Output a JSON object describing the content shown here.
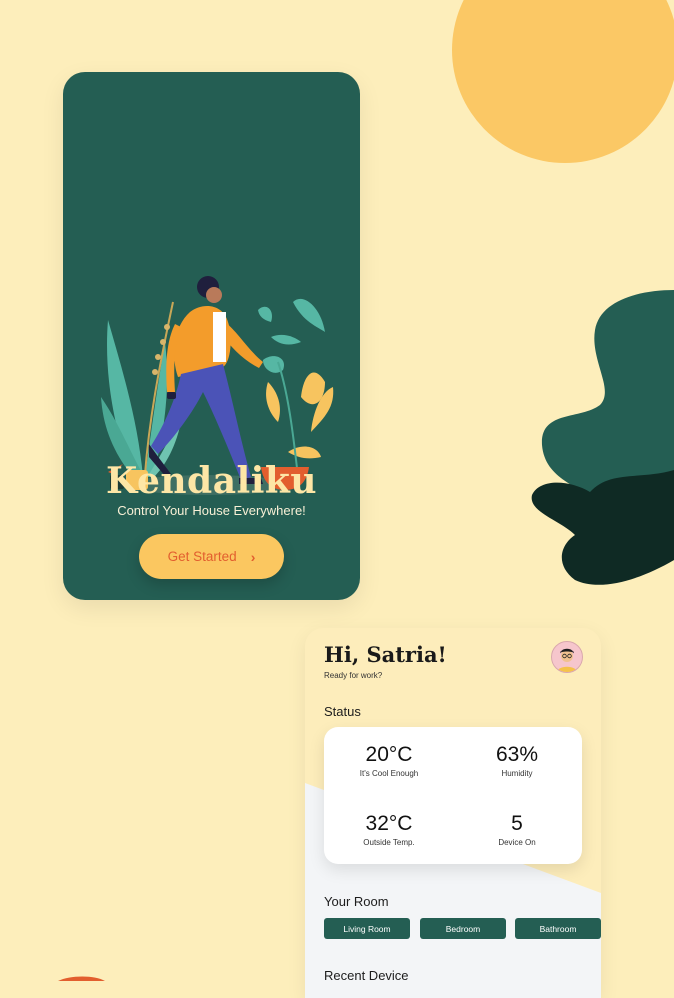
{
  "colors": {
    "background": "#fdeebb",
    "primary_green": "#245e53",
    "dark_green": "#0f2a24",
    "accent_yellow": "#fbc760",
    "accent_orange": "#e25e2e"
  },
  "onboarding": {
    "illustration": "walking-man-with-plants",
    "title": "Kendaliku",
    "tagline": "Control Your House Everywhere!",
    "cta_label": "Get Started",
    "cta_icon": "chevron-right-icon"
  },
  "dashboard": {
    "greeting": "Hi, Satria!",
    "subtitle": "Ready for work?",
    "avatar": "user-avatar",
    "status_label": "Status",
    "stats": [
      {
        "value": "20°C",
        "label": "It's Cool Enough"
      },
      {
        "value": "63%",
        "label": "Humidity"
      },
      {
        "value": "32°C",
        "label": "Outside Temp."
      },
      {
        "value": "5",
        "label": "Device On"
      }
    ],
    "rooms_label": "Your Room",
    "rooms": [
      "Living Room",
      "Bedroom",
      "Bathroom"
    ],
    "recent_label": "Recent Device"
  }
}
